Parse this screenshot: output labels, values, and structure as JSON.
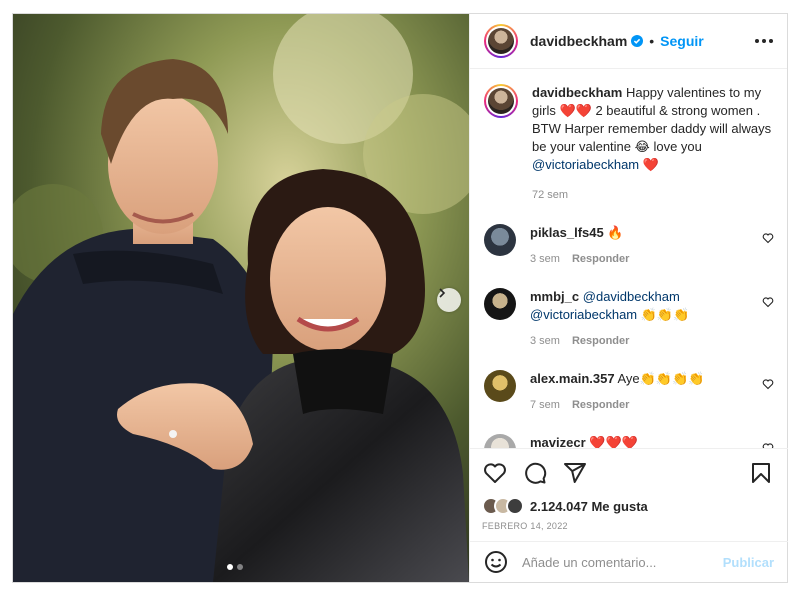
{
  "post": {
    "username": "davidbeckham",
    "follow_label": "Seguir",
    "separator": "•",
    "verified_icon": "verified-badge-icon",
    "more_icon": "more-options-icon"
  },
  "caption": {
    "username": "davidbeckham",
    "text_1": "Happy valentines to my girls",
    "hearts_1": "❤️❤️",
    "text_2": "2 beautiful & strong women . BTW Harper remember daddy will always be your valentine",
    "emoji_laugh": "😂",
    "text_3": "love you",
    "mention": "@victoriabeckham",
    "hearts_2": "❤️",
    "time": "72 sem"
  },
  "comments": [
    {
      "username": "piklas_lfs45",
      "text": "🔥",
      "time": "3 sem",
      "reply": "Responder"
    },
    {
      "username": "mmbj_c",
      "mention_1": "@davidbeckham",
      "mention_2": "@victoriabeckham",
      "text": "👏👏👏",
      "time": "3 sem",
      "reply": "Responder"
    },
    {
      "username": "alex.main.357",
      "text": "Aye👏👏👏👏",
      "time": "7 sem",
      "reply": "Responder"
    },
    {
      "username": "mavizecr",
      "text": "❤️❤️❤️"
    }
  ],
  "actions": {
    "like_icon": "heart-icon",
    "comment_icon": "comment-icon",
    "share_icon": "share-icon",
    "save_icon": "bookmark-icon"
  },
  "likes": {
    "count_text": "2.124.047 Me gusta"
  },
  "date": "FEBRERO 14, 2022",
  "add_comment": {
    "emoji_icon": "emoji-icon",
    "placeholder": "Añade un comentario...",
    "post_label": "Publicar"
  },
  "carousel": {
    "total": 2,
    "active_index": 0
  },
  "colors": {
    "link": "#0095f6",
    "mention": "#00376b",
    "muted": "#8e8e8e",
    "heart": "#e0202a"
  }
}
